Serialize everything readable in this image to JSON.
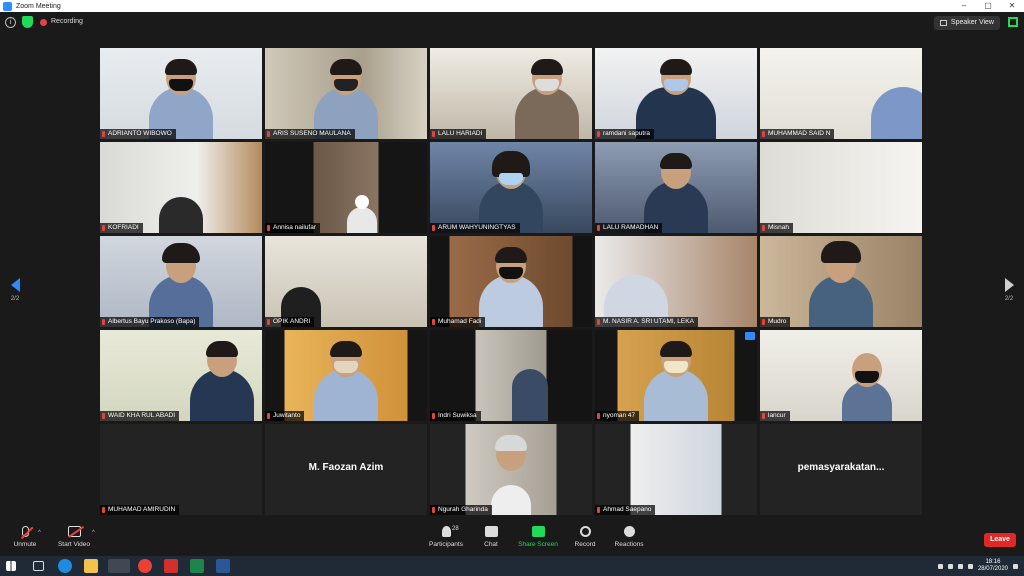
{
  "window": {
    "title": "Zoom Meeting"
  },
  "topbar": {
    "recording_label": "Recording",
    "view_label": "Speaker View"
  },
  "paging": {
    "left_page": "2/2",
    "right_page": "2/2"
  },
  "tiles": [
    {
      "name": "ADRIANTO WIBOWO"
    },
    {
      "name": "ARIS SUSENO MAULANA"
    },
    {
      "name": "LALU HARIADI"
    },
    {
      "name": "ramdani saputra"
    },
    {
      "name": "MUHAMMAD SAID N"
    },
    {
      "name": "KOFRIADI"
    },
    {
      "name": "Annisa nailufar"
    },
    {
      "name": "ARUM WAHYUNINGTYAS"
    },
    {
      "name": "LALU RAMADHAN"
    },
    {
      "name": "Misnah"
    },
    {
      "name": "Albertus Bayu Prakoso (Bapa)"
    },
    {
      "name": "OPIK ANDRI"
    },
    {
      "name": "Muhamad Fadi"
    },
    {
      "name": "M. NASIR A. SRI UTAMI, LEKA"
    },
    {
      "name": "Mudro"
    },
    {
      "name": "WAID KHA RUL ABADI"
    },
    {
      "name": "Juwitanto"
    },
    {
      "name": "Indri Suwiksa"
    },
    {
      "name": "nyoman 47"
    },
    {
      "name": "lancur"
    },
    {
      "name": "MUHAMAD AMIRUDIN"
    },
    {
      "name": "M. Faozan Azim",
      "display": "M. Faozan Azim"
    },
    {
      "name": "Ngurah Gharinda"
    },
    {
      "name": "Ahmad Saepano"
    },
    {
      "name": "pemasyarakatan...",
      "display": "pemasyarakatan..."
    }
  ],
  "toolbar": {
    "unmute": "Unmute",
    "start_video": "Start Video",
    "participants": "Participants",
    "participants_count": "28",
    "chat": "Chat",
    "share_screen": "Share Screen",
    "record": "Record",
    "reactions": "Reactions",
    "leave": "Leave"
  },
  "taskbar": {
    "time": "18:16",
    "date": "28/07/2020"
  },
  "colors": {
    "accent": "#2d8cff",
    "share_green": "#23d959",
    "leave_red": "#e02828",
    "active_speaker": "#d4d94a"
  }
}
